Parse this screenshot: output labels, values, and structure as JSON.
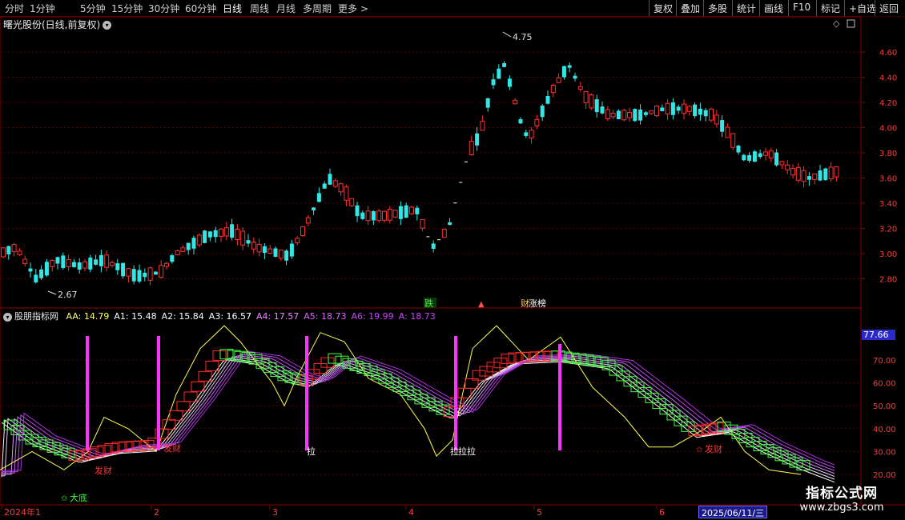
{
  "toolbar": {
    "periods": [
      "分时",
      "1分钟",
      "5分钟",
      "15分钟",
      "30分钟",
      "60分钟",
      "日线",
      "周线",
      "月线",
      "多周期",
      "更多 >"
    ],
    "active_period": "日线",
    "right_buttons": [
      "复权",
      "叠加",
      "多股",
      "统计",
      "画线",
      "F10",
      "标记",
      "+自选",
      "返回"
    ]
  },
  "main_pane": {
    "title": "曙光股份(日线,前复权)",
    "price_axis": [
      "4.60",
      "4.40",
      "4.20",
      "4.00",
      "3.80",
      "3.60",
      "3.40",
      "3.20",
      "3.00",
      "2.80"
    ],
    "high_label": "4.75",
    "low_label": "2.67",
    "badges": [
      "跌",
      "▲",
      "财",
      "涨榜"
    ]
  },
  "indicator_pane": {
    "name": "股朋指标网",
    "values": [
      {
        "label": "AA:",
        "value": "14.79",
        "color": "#ffff66"
      },
      {
        "label": "A1:",
        "value": "15.48",
        "color": "#ffffff"
      },
      {
        "label": "A2:",
        "value": "15.84",
        "color": "#ffffff"
      },
      {
        "label": "A3:",
        "value": "16.57",
        "color": "#ffffff"
      },
      {
        "label": "A4:",
        "value": "17.57",
        "color": "#ee88ff"
      },
      {
        "label": "A5:",
        "value": "18.73",
        "color": "#dd66ff"
      },
      {
        "label": "A6:",
        "value": "19.99",
        "color": "#cc44ff"
      },
      {
        "label": "A:",
        "value": "18.73",
        "color": "#cc44ff"
      }
    ],
    "value_axis": [
      "70.00",
      "60.00",
      "50.00",
      "40.00",
      "30.00",
      "20.00"
    ],
    "current_value": "77.66",
    "signals": [
      "发财",
      "发财",
      "拉",
      "拉拉",
      "拉",
      "发财",
      "大底"
    ]
  },
  "time_axis": {
    "labels": [
      "2024年1",
      "2",
      "3",
      "4",
      "5",
      "6"
    ],
    "cursor_date": "2025/06/11/三"
  },
  "watermark": {
    "line1": "指标公式网",
    "line2": "www.zbgs3.com"
  }
}
